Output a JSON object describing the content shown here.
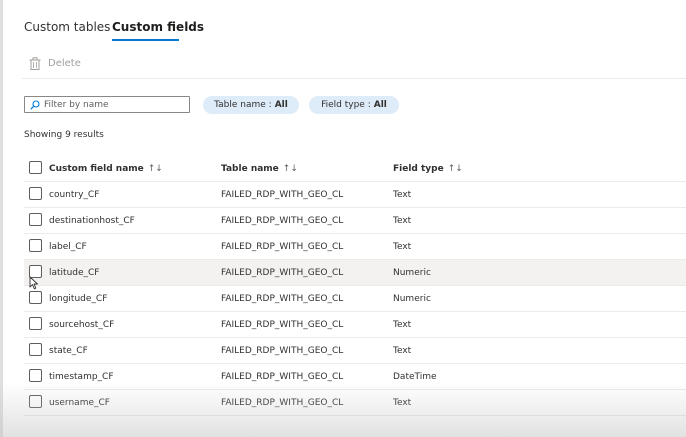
{
  "tabs": [
    {
      "label": "Custom tables"
    },
    {
      "label": "Custom fields"
    }
  ],
  "commands": {
    "delete_label": "Delete",
    "delete_icon": "trash-icon"
  },
  "filter": {
    "placeholder": "Filter by name",
    "value": ""
  },
  "pills": [
    {
      "label": "Table name :",
      "value": "All"
    },
    {
      "label": "Field type :",
      "value": "All"
    }
  ],
  "results_text": "Showing 9 results",
  "columns": [
    {
      "label": "Custom field name",
      "sort": "↑↓"
    },
    {
      "label": "Table name",
      "sort": "↑↓"
    },
    {
      "label": "Field type",
      "sort": "↑↓"
    }
  ],
  "rows": [
    {
      "name": "country_CF",
      "table": "FAILED_RDP_WITH_GEO_CL",
      "type": "Text"
    },
    {
      "name": "destinationhost_CF",
      "table": "FAILED_RDP_WITH_GEO_CL",
      "type": "Text"
    },
    {
      "name": "label_CF",
      "table": "FAILED_RDP_WITH_GEO_CL",
      "type": "Text"
    },
    {
      "name": "latitude_CF",
      "table": "FAILED_RDP_WITH_GEO_CL",
      "type": "Numeric"
    },
    {
      "name": "longitude_CF",
      "table": "FAILED_RDP_WITH_GEO_CL",
      "type": "Numeric"
    },
    {
      "name": "sourcehost_CF",
      "table": "FAILED_RDP_WITH_GEO_CL",
      "type": "Text"
    },
    {
      "name": "state_CF",
      "table": "FAILED_RDP_WITH_GEO_CL",
      "type": "Text"
    },
    {
      "name": "timestamp_CF",
      "table": "FAILED_RDP_WITH_GEO_CL",
      "type": "DateTime"
    },
    {
      "name": "username_CF",
      "table": "FAILED_RDP_WITH_GEO_CL",
      "type": "Text"
    }
  ],
  "colors": {
    "accent": "#0078d4",
    "pill_bg": "#deecf9",
    "hover_row": "#f3f2f1"
  }
}
